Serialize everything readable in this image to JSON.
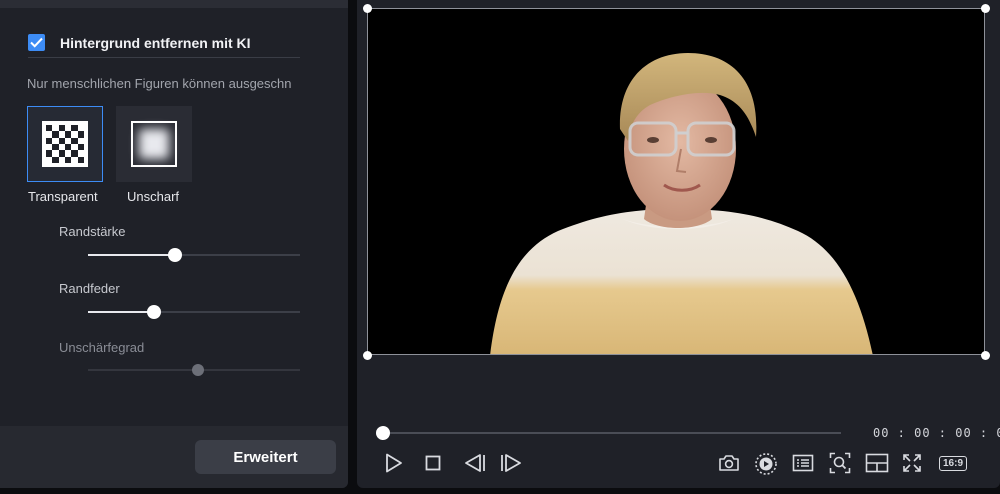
{
  "background_removal": {
    "checkbox_label": "Hintergrund entfernen mit KI",
    "checked": true,
    "hint": "Nur menschlichen Figuren können ausgeschn"
  },
  "modes": [
    {
      "label": "Transparent",
      "icon": "checkerboard-icon",
      "selected": true
    },
    {
      "label": "Unscharf",
      "icon": "blur-icon",
      "selected": false
    }
  ],
  "sliders": [
    {
      "label": "Randstärke",
      "value_fraction": 0.41,
      "enabled": true
    },
    {
      "label": "Randfeder",
      "value_fraction": 0.31,
      "enabled": true
    },
    {
      "label": "Unschärfegrad",
      "value_fraction": 0.52,
      "enabled": false
    }
  ],
  "advanced_button": "Erweitert",
  "player": {
    "timecode": "00:00:00:00",
    "progress_fraction": 0.0,
    "aspect_ratio": "16:9"
  },
  "colors": {
    "accent": "#3d8cf5",
    "panel_bg": "#1f2128"
  }
}
